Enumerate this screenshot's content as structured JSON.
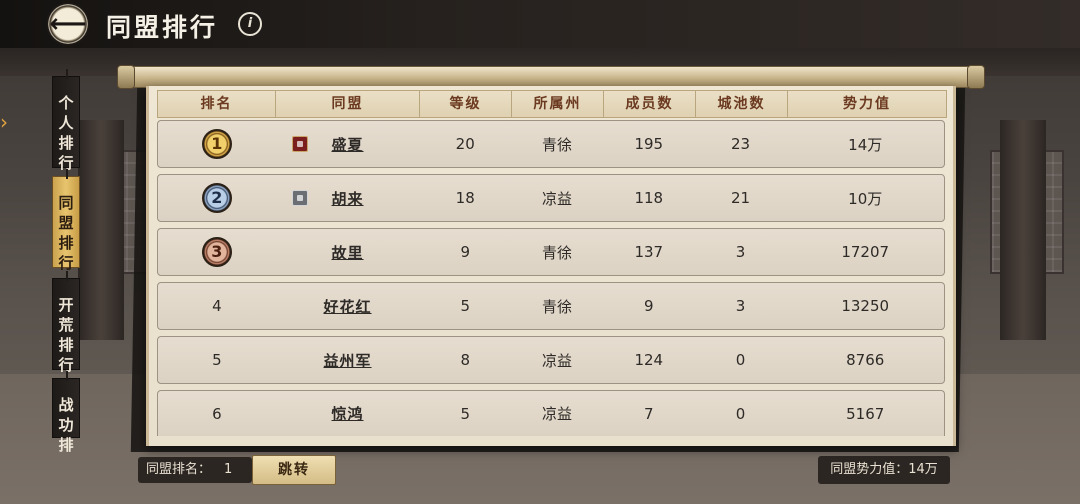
{
  "header": {
    "title": "同盟排行",
    "back_glyph": "⟵",
    "info_glyph": "i"
  },
  "side_tabs": [
    {
      "label": [
        "个",
        "人",
        "排",
        "行"
      ],
      "active": false
    },
    {
      "label": [
        "同",
        "盟",
        "排",
        "行"
      ],
      "active": true
    },
    {
      "label": [
        "开",
        "荒",
        "排",
        "行"
      ],
      "active": false
    },
    {
      "label": [
        "战",
        "功",
        "排"
      ],
      "active": false
    }
  ],
  "table": {
    "columns": [
      "排名",
      "同盟",
      "等级",
      "所属州",
      "成员数",
      "城池数",
      "势力值"
    ],
    "rows": [
      {
        "rank": "1",
        "medal": "gold",
        "flag": "red",
        "name": "盛夏",
        "level": "20",
        "state": "青徐",
        "members": "195",
        "cities": "23",
        "power": "14万"
      },
      {
        "rank": "2",
        "medal": "silver",
        "flag": "grey",
        "name": "胡来",
        "level": "18",
        "state": "凉益",
        "members": "118",
        "cities": "21",
        "power": "10万"
      },
      {
        "rank": "3",
        "medal": "bronze",
        "flag": "",
        "name": "故里",
        "level": "9",
        "state": "青徐",
        "members": "137",
        "cities": "3",
        "power": "17207"
      },
      {
        "rank": "4",
        "medal": "",
        "flag": "",
        "name": "好花红",
        "level": "5",
        "state": "青徐",
        "members": "9",
        "cities": "3",
        "power": "13250"
      },
      {
        "rank": "5",
        "medal": "",
        "flag": "",
        "name": "益州军",
        "level": "8",
        "state": "凉益",
        "members": "124",
        "cities": "0",
        "power": "8766"
      },
      {
        "rank": "6",
        "medal": "",
        "flag": "",
        "name": "惊鸿",
        "level": "5",
        "state": "凉益",
        "members": "7",
        "cities": "0",
        "power": "5167"
      }
    ]
  },
  "footer": {
    "alliance_rank_label": "同盟排名：",
    "alliance_rank_value": "1",
    "jump_label": "跳转",
    "alliance_power_label": "同盟势力值：14万"
  }
}
